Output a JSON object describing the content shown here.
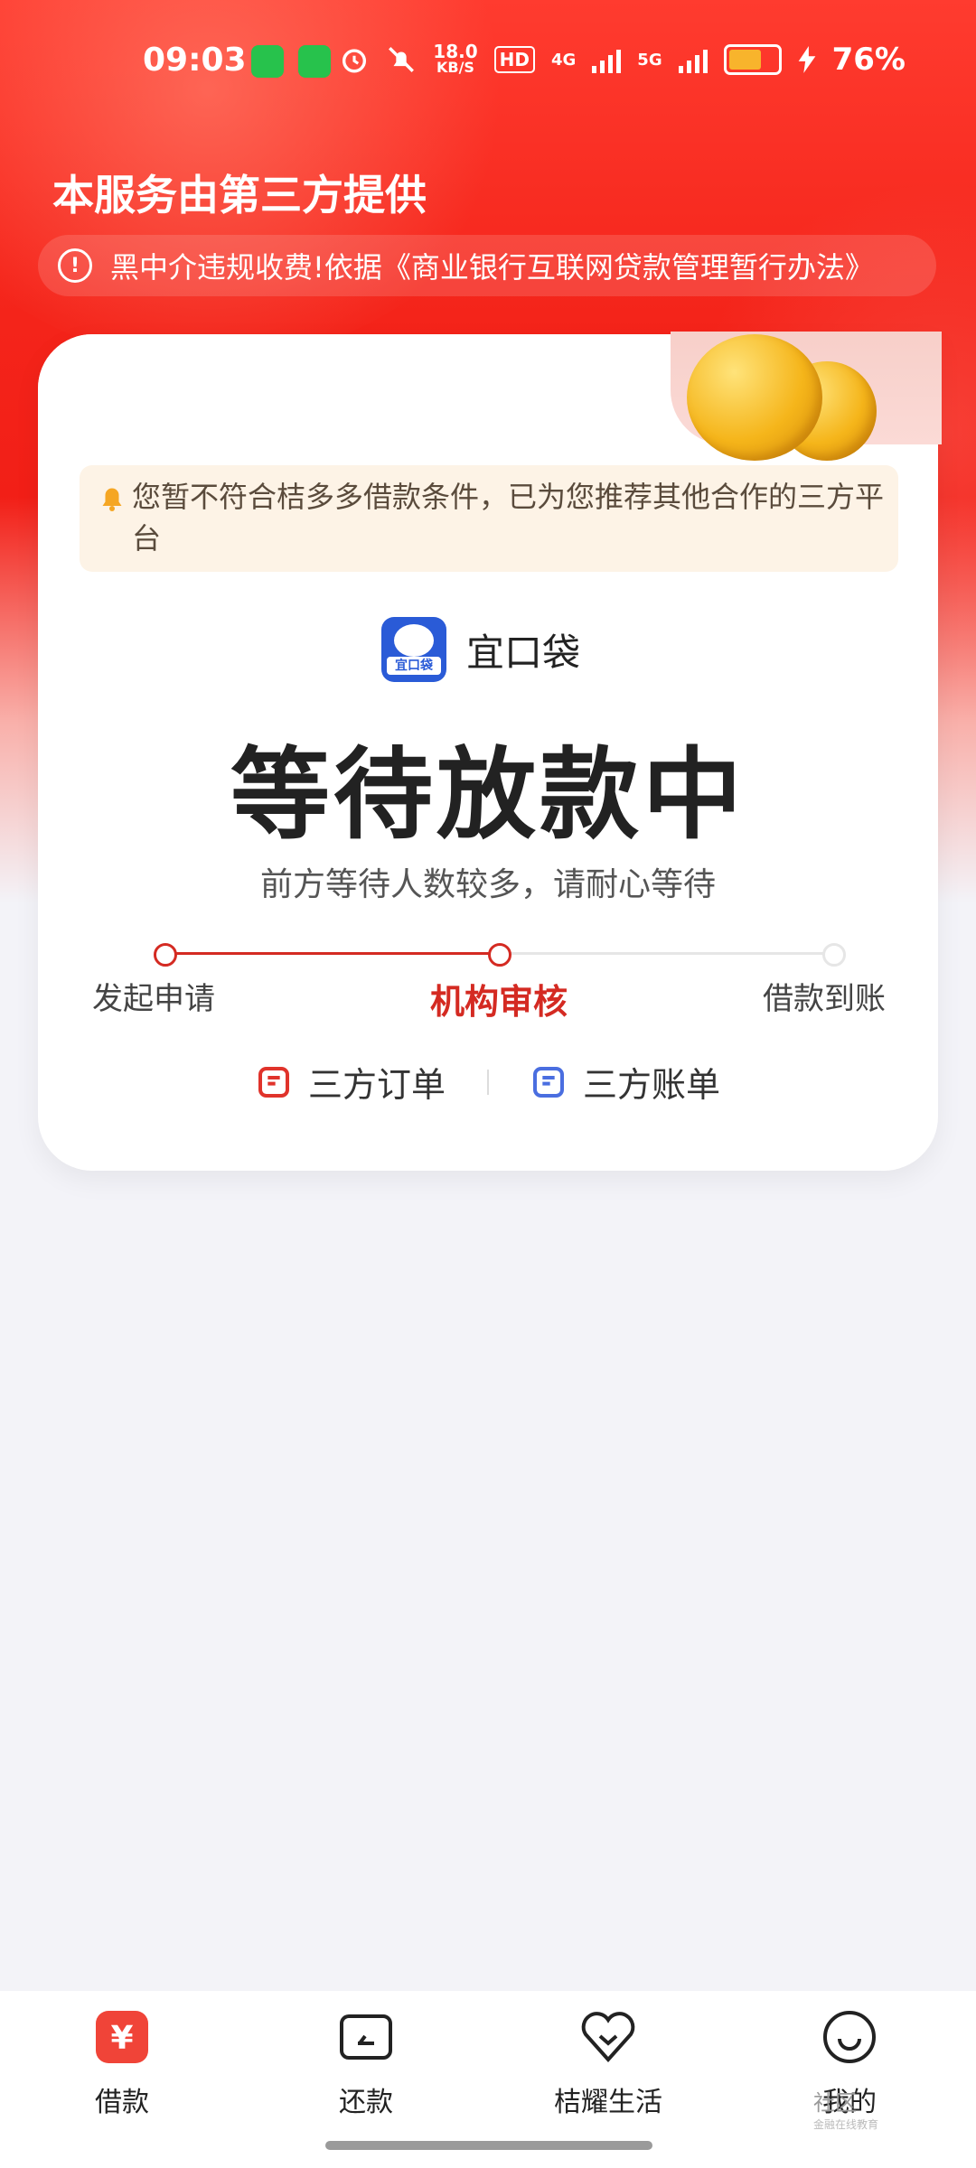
{
  "status_bar": {
    "time": "09:03",
    "net_speed_value": "18.0",
    "net_speed_unit": "KB/S",
    "hd": "HD",
    "net1": "4G",
    "net2": "5G",
    "battery": "76%",
    "battery_level": 0.76
  },
  "header": {
    "provider_title": "本服务由第三方提供",
    "notice_text": "黑中介违规收费!依据《商业银行互联网贷款管理暂行办法》"
  },
  "card": {
    "alert_text": "您暂不符合桔多多借款条件，已为您推荐其他合作的三方平台",
    "partner_logo_text": "宜口袋",
    "partner_name": "宜口袋",
    "status_title": "等待放款中",
    "wait_hint": "前方等待人数较多，请耐心等待",
    "steps": [
      {
        "label": "发起申请",
        "state": "done"
      },
      {
        "label": "机构审核",
        "state": "current"
      },
      {
        "label": "借款到账",
        "state": "pending"
      }
    ],
    "links": [
      {
        "label": "三方订单",
        "icon": "order-doc-icon",
        "color": "#e0332b"
      },
      {
        "label": "三方账单",
        "icon": "bill-doc-icon",
        "color": "#4a6ee0"
      }
    ]
  },
  "tabbar": {
    "items": [
      {
        "label": "借款",
        "icon": "loan-icon",
        "active": true
      },
      {
        "label": "还款",
        "icon": "repay-icon",
        "active": false
      },
      {
        "label": "桔耀生活",
        "icon": "life-icon",
        "active": false
      },
      {
        "label": "我的",
        "icon": "profile-icon",
        "active": false
      }
    ]
  },
  "watermark": {
    "title": "社区",
    "subtitle": "金融在线教育"
  },
  "colors": {
    "brand_red": "#e0332b",
    "accent_blue": "#4a6ee0",
    "step_red": "#d42a22"
  }
}
